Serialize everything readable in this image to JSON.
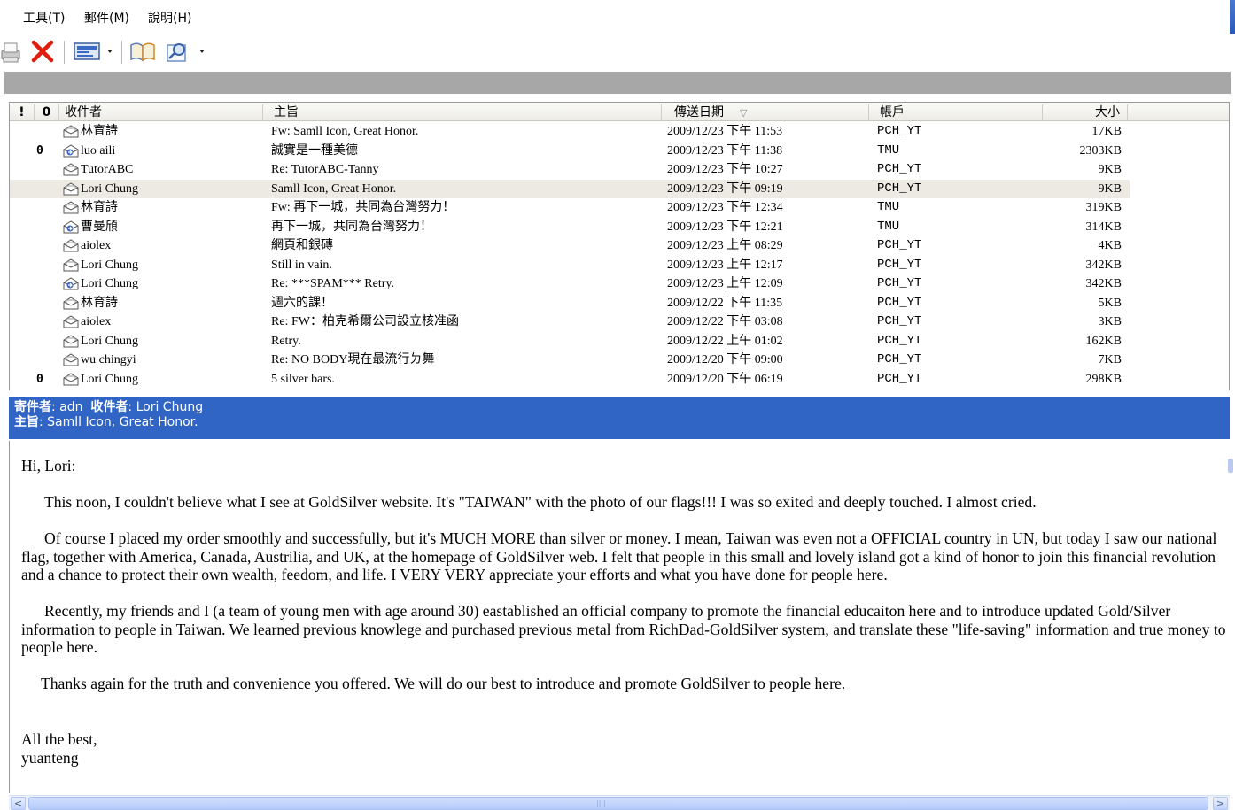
{
  "menu": {
    "items": [
      {
        "label": "工具(T)"
      },
      {
        "label": "郵件(M)"
      },
      {
        "label": "說明(H)"
      }
    ]
  },
  "toolbar": {
    "buttons": [
      {
        "icon": "print-icon"
      },
      {
        "icon": "delete-icon"
      },
      {
        "icon": "send-receive-icon"
      },
      {
        "icon": "address-book-icon"
      },
      {
        "icon": "find-icon"
      }
    ]
  },
  "columns": {
    "flag": "!",
    "attach": "0",
    "to": "收件者",
    "subject": "主旨",
    "date": "傳送日期",
    "sort_indicator": "▽",
    "account": "帳戶",
    "size": "大小"
  },
  "messages": [
    {
      "flagged": false,
      "attach": "",
      "env": "read",
      "to": "林育詩",
      "subject": "Fw: Samll Icon, Great Honor.",
      "date": "2009/12/23 下午 11:53",
      "account": "PCH_YT",
      "size": "17KB"
    },
    {
      "flagged": false,
      "attach": "0",
      "env": "reply",
      "to": "luo aili",
      "subject": "誠實是一種美德",
      "date": "2009/12/23 下午 11:38",
      "account": "TMU",
      "size": "2303KB"
    },
    {
      "flagged": false,
      "attach": "",
      "env": "read",
      "to": "TutorABC",
      "subject": "Re: TutorABC-Tanny",
      "date": "2009/12/23 下午 10:27",
      "account": "PCH_YT",
      "size": "9KB"
    },
    {
      "flagged": true,
      "attach": "",
      "env": "read",
      "to": "Lori Chung",
      "subject": "Samll Icon, Great Honor.",
      "date": "2009/12/23 下午 09:19",
      "account": "PCH_YT",
      "size": "9KB",
      "selected": true
    },
    {
      "flagged": false,
      "attach": "",
      "env": "read",
      "to": "林育詩",
      "subject": "Fw: 再下一城，共同為台灣努力！",
      "date": "2009/12/23 下午 12:34",
      "account": "TMU",
      "size": "319KB"
    },
    {
      "flagged": false,
      "attach": "",
      "env": "reply",
      "to": "曹曼頎",
      "subject": "再下一城，共同為台灣努力！",
      "date": "2009/12/23 下午 12:21",
      "account": "TMU",
      "size": "314KB"
    },
    {
      "flagged": false,
      "attach": "",
      "env": "read",
      "to": "aiolex",
      "subject": "網頁和銀磚",
      "date": "2009/12/23 上午 08:29",
      "account": "PCH_YT",
      "size": "4KB"
    },
    {
      "flagged": true,
      "attach": "",
      "env": "read",
      "to": "Lori Chung",
      "subject": "Still in vain.",
      "date": "2009/12/23 上午 12:17",
      "account": "PCH_YT",
      "size": "342KB"
    },
    {
      "flagged": false,
      "attach": "",
      "env": "reply",
      "to": "Lori Chung",
      "subject": "Re: ***SPAM*** Retry.",
      "date": "2009/12/23 上午 12:09",
      "account": "PCH_YT",
      "size": "342KB"
    },
    {
      "flagged": false,
      "attach": "",
      "env": "read",
      "to": "林育詩",
      "subject": "週六的課！",
      "date": "2009/12/22 下午 11:35",
      "account": "PCH_YT",
      "size": "5KB"
    },
    {
      "flagged": false,
      "attach": "",
      "env": "read",
      "to": "aiolex",
      "subject": "Re: FW：柏克希爾公司設立核准函",
      "date": "2009/12/22 下午 03:08",
      "account": "PCH_YT",
      "size": "3KB"
    },
    {
      "flagged": true,
      "attach": "",
      "env": "read",
      "to": "Lori Chung",
      "subject": "Retry.",
      "date": "2009/12/22 上午 01:02",
      "account": "PCH_YT",
      "size": "162KB"
    },
    {
      "flagged": false,
      "attach": "",
      "env": "read",
      "to": "wu chingyi",
      "subject": "Re: NO BODY現在最流行ㄉ舞",
      "date": "2009/12/20 下午 09:00",
      "account": "PCH_YT",
      "size": "7KB"
    },
    {
      "flagged": true,
      "attach": "0",
      "env": "read",
      "to": "Lori Chung",
      "subject": "5 silver bars.",
      "date": "2009/12/20 下午 06:19",
      "account": "PCH_YT",
      "size": "298KB"
    }
  ],
  "preview": {
    "from_label": "寄件者",
    "from": "adn",
    "to_label": "收件者",
    "to": "Lori Chung",
    "subject_label": "主旨",
    "subject": "Samll Icon, Great Honor.",
    "sep": ": ",
    "body": {
      "greeting": "Hi, Lori:",
      "p1": "This noon, I couldn't believe what I see at GoldSilver website. It's \"TAIWAN\" with the photo of our flags!!! I was so exited and deeply touched. I almost cried.",
      "p2": "Of course I placed my order smoothly and successfully, but it's MUCH MORE than silver or money. I mean, Taiwan was even not a OFFICIAL country in UN, but today I saw our national flag, together with America, Canada, Austrilia, and UK, at the homepage of GoldSilver web. I felt that people in this small and lovely island got a kind of honor to join this financial revolution and a chance to protect their own wealth, feedom, and life. I VERY VERY appreciate your efforts and what you have done for people here.",
      "p3": "Recently, my friends and I (a team of young men with age around 30) eastablished an official company to promote the financial educaiton here and to introduce updated Gold/Silver information to people in Taiwan. We learned previous knowlege and purchased previous metal from RichDad-GoldSilver system, and translate these \"life-saving\" information and true money to people here.",
      "p4": "Thanks again for the truth and convenience you offered.  We will do our best to introduce and promote GoldSilver to people here.",
      "closing": "All the best,",
      "signature": "yuanteng"
    }
  },
  "scrollbar": {
    "left_arrow": "<",
    "right_arrow": ">",
    "grip": "||||"
  },
  "colors": {
    "flag": "#e00000",
    "preview_header": "#3165c5",
    "selected_row": "#eceae2",
    "grey_band": "#a7a7a7"
  }
}
